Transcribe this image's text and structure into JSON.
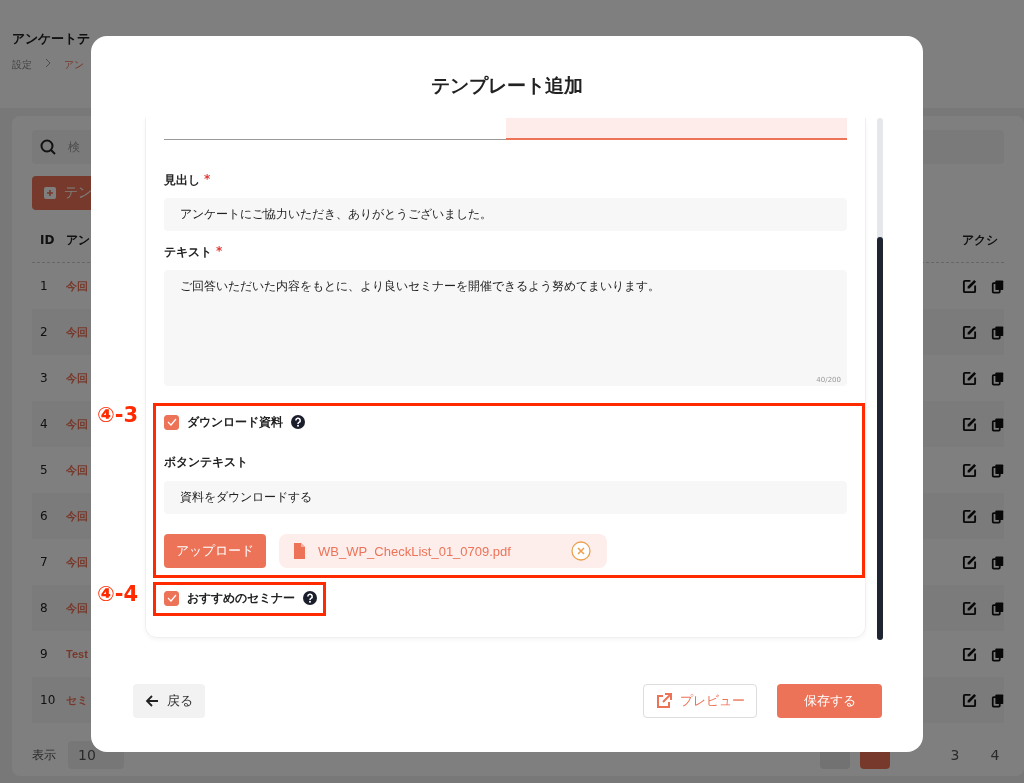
{
  "background": {
    "page_title": "アンケートテ",
    "breadcrumb": [
      "設定",
      "アン"
    ],
    "search": {
      "placeholder": "検"
    },
    "add_button": "テン",
    "table": {
      "columns": [
        "ID",
        "アン",
        "アクシ"
      ],
      "rows": [
        {
          "id": "1",
          "title": "今回"
        },
        {
          "id": "2",
          "title": "今回"
        },
        {
          "id": "3",
          "title": "今回"
        },
        {
          "id": "4",
          "title": "今回"
        },
        {
          "id": "5",
          "title": "今回"
        },
        {
          "id": "6",
          "title": "今回"
        },
        {
          "id": "7",
          "title": "今回"
        },
        {
          "id": "8",
          "title": "今回"
        },
        {
          "id": "9",
          "title": "Test"
        },
        {
          "id": "10",
          "title": "セミ"
        }
      ]
    },
    "footer": {
      "show_label": "表示",
      "page_size": "10",
      "pages": [
        "3",
        "4"
      ]
    }
  },
  "modal": {
    "title": "テンプレート追加",
    "tabs": [
      {
        "selected": false
      },
      {
        "selected": true
      }
    ],
    "fields": [
      {
        "kind": "input",
        "label": "見出し",
        "required_mark": "*",
        "value": "アンケートにご協力いただき、ありがとうございました。"
      },
      {
        "kind": "textarea",
        "label": "テキスト",
        "required_mark": "*",
        "value": "ご回答いただいた内容をもとに、より良いセミナーを開催できるよう努めてまいります。",
        "counter": "40/200"
      }
    ],
    "download": {
      "annotation": "④-3",
      "label": "ダウンロード資料",
      "checked": true,
      "button_text_label": "ボタンテキスト",
      "button_text_value": "資料をダウンロードする",
      "upload_button": "アップロード",
      "file_name": "WB_WP_CheckList_01_0709.pdf"
    },
    "seminar": {
      "annotation": "④-4",
      "label": "おすすめのセミナー",
      "checked": true
    },
    "buttons": {
      "back": "戻る",
      "preview": "プレビュー",
      "save": "保存する"
    }
  }
}
